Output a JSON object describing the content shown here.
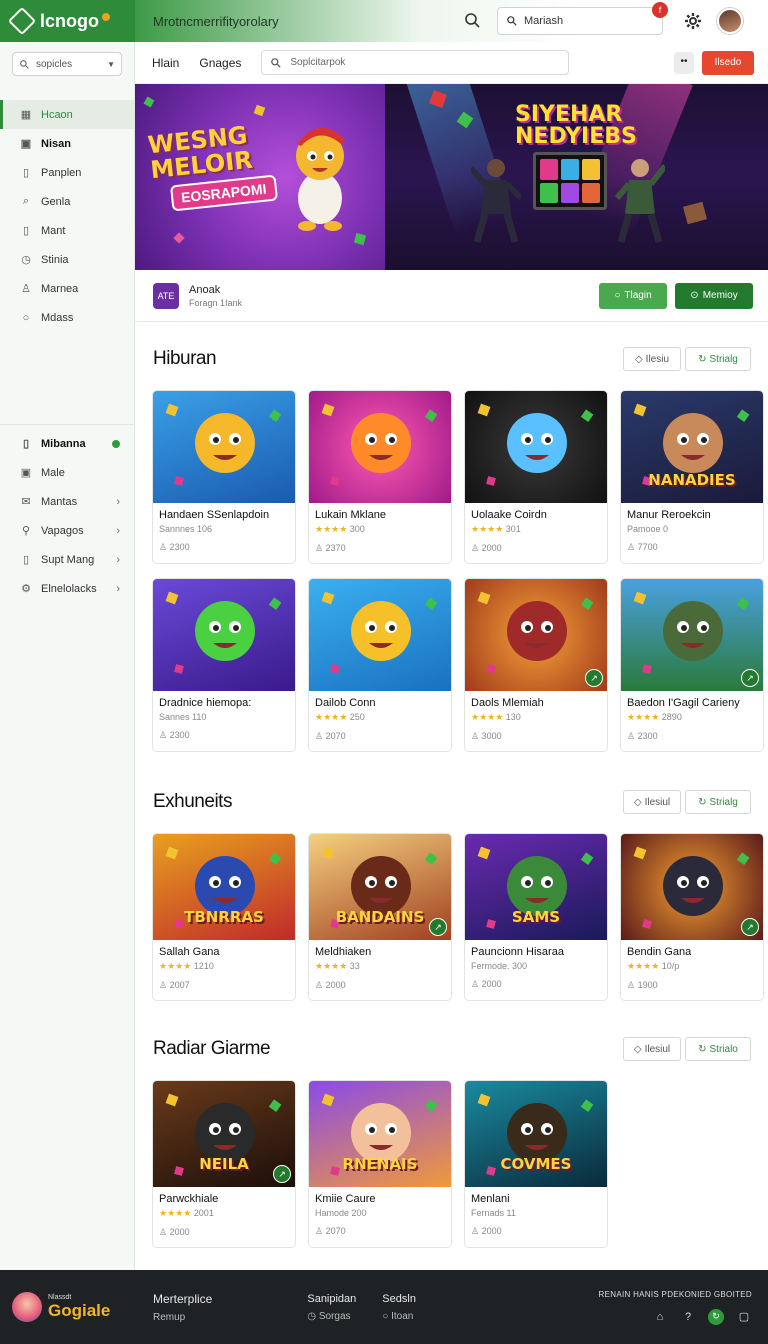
{
  "topbar": {
    "logo": "lcnogo",
    "title": "Mrotncmerrifityorolary",
    "search_value": "Mariash",
    "notif_count": "f"
  },
  "sidebar": {
    "search_placeholder": "sopicles",
    "items_top": [
      {
        "label": "Hcaon",
        "icon": "grid-icon",
        "active": true
      },
      {
        "label": "Nisan",
        "icon": "square-icon",
        "bold": true
      },
      {
        "label": "Panplen",
        "icon": "doc-icon"
      },
      {
        "label": "Genla",
        "icon": "search-icon"
      },
      {
        "label": "Mant",
        "icon": "doc-icon"
      },
      {
        "label": "Stinia",
        "icon": "clock-icon"
      },
      {
        "label": "Marnea",
        "icon": "user-icon"
      },
      {
        "label": "Mdass",
        "icon": "circle-icon"
      }
    ],
    "items_bottom": [
      {
        "label": "Mibanna",
        "icon": "doc-icon",
        "trailing": "dot",
        "bold": true
      },
      {
        "label": "Male",
        "icon": "square-icon",
        "trailing": ""
      },
      {
        "label": "Mantas",
        "icon": "mail-icon",
        "trailing": "arrow"
      },
      {
        "label": "Vapagos",
        "icon": "person-icon",
        "trailing": "arrow"
      },
      {
        "label": "Supt Mang",
        "icon": "doc-icon",
        "trailing": "arrow"
      },
      {
        "label": "Elnelolacks",
        "icon": "gear-icon",
        "trailing": "arrow"
      }
    ]
  },
  "toolbar": {
    "tab1": "Hlain",
    "tab2": "Gnages",
    "search_placeholder": "Soplcitarpok",
    "more_label": "••",
    "action_label": "Ilsedo"
  },
  "hero": {
    "left_text_1": "WESNG",
    "left_text_2": "MELOIR",
    "left_badge": "EOSRAPOMI",
    "right_text_1": "SIYEHAR",
    "right_text_2": "NEDYIEBS"
  },
  "infobar": {
    "app_icon_text": "ATE",
    "title": "Anoak",
    "subtitle": "Foragn 1Iank",
    "btn1": "Tlagin",
    "btn2": "Memioy"
  },
  "sections": [
    {
      "title": "Hiburan",
      "btn1": "Ilesiu",
      "btn2": "Strialg",
      "cards": [
        {
          "name": "Handaen SSenlapdoin",
          "meta": "Sannnes 106",
          "stars": "",
          "count": "2300",
          "scene": "bear"
        },
        {
          "name": "Lukain Mklane",
          "meta": "300",
          "stars": "★★★★",
          "count": "2370",
          "scene": "candy"
        },
        {
          "name": "Uolaake Coirdn",
          "meta": "301",
          "stars": "★★★★",
          "count": "2000",
          "scene": "tablet"
        },
        {
          "name": "Manur Reroekcin",
          "meta": "Pamooe 0",
          "stars": "",
          "count": "7700",
          "scene": "group",
          "label": "NANADIES"
        },
        {
          "name": "Dradnice hiemopa:",
          "meta": "Sannes 110",
          "stars": "",
          "count": "2300",
          "scene": "green"
        },
        {
          "name": "Dailob Conn",
          "meta": "250",
          "stars": "★★★★",
          "count": "2070",
          "scene": "yellow"
        },
        {
          "name": "Daols Mlemiah",
          "meta": "130",
          "stars": "★★★★",
          "count": "3000",
          "scene": "hero",
          "badge": "↗"
        },
        {
          "name": "Baedon I'Gagil Carieny",
          "meta": "2890",
          "stars": "★★★★",
          "count": "2300",
          "scene": "forest",
          "badge": "↗"
        }
      ]
    },
    {
      "title": "Exhuneits",
      "btn1": "Ilesiul",
      "btn2": "Strialg",
      "cards": [
        {
          "name": "Sallah Gana",
          "meta": "1210",
          "stars": "★★★★",
          "count": "2007",
          "scene": "team",
          "label": "TBNRRAS"
        },
        {
          "name": "Meldhiaken",
          "meta": "33",
          "stars": "★★★★",
          "count": "2000",
          "scene": "warrior",
          "label": "BANDAINS",
          "badge": "↗"
        },
        {
          "name": "Pauncionn Hisaraa",
          "meta": "Fermode. 300",
          "stars": "",
          "count": "2000",
          "scene": "soldier",
          "label": "SAMS"
        },
        {
          "name": "Bendin Gana",
          "meta": "10/p",
          "stars": "★★★★",
          "count": "1900",
          "scene": "fighters",
          "badge": "↗"
        }
      ]
    },
    {
      "title": "Radiar Giarme",
      "btn1": "Ilesiul",
      "btn2": "Strialo",
      "cards": [
        {
          "name": "Parwckhiale",
          "meta": "2001",
          "stars": "★★★★",
          "count": "2000",
          "scene": "dark",
          "label": "NEILA",
          "badge": "↗"
        },
        {
          "name": "Kmiie Caure",
          "meta": "Hamode 200",
          "stars": "",
          "count": "2070",
          "scene": "kid",
          "label": "RNENAIS"
        },
        {
          "name": "Menlani",
          "meta": "Fernads 11",
          "stars": "",
          "count": "2000",
          "scene": "cov",
          "label": "COVMES"
        }
      ]
    }
  ],
  "footer": {
    "brand_small": "Nlassdt",
    "brand": "Gogiale",
    "col1_title": "Merterplice",
    "col1_sub": "Remup",
    "col2_title": "Sanipidan",
    "col2_sub": "Sorgas",
    "col3_title": "Sedsln",
    "col3_sub": "Itoan",
    "right_line": "RENAIN HANIS PDEKONIED  GBOITED"
  },
  "colors": {
    "brand_green": "#2e8b3a",
    "accent_red": "#e5482d",
    "star": "#f0b323"
  }
}
